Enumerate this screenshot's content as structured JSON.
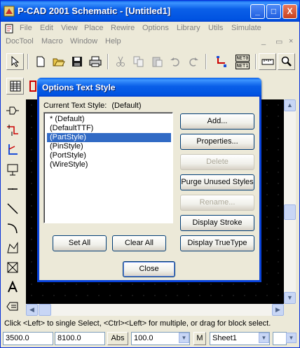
{
  "window": {
    "title": "P-CAD 2001 Schematic - [Untitled1]"
  },
  "title_buttons": {
    "minimize": "_",
    "maximize": "□",
    "close": "X"
  },
  "menu1": [
    "File",
    "Edit",
    "View",
    "Place",
    "Rewire",
    "Options",
    "Library",
    "Utils",
    "Simulate"
  ],
  "menu2": [
    "DocTool",
    "Macro",
    "Window",
    "Help"
  ],
  "toolbar_text": {
    "netlist_top": "NET0",
    "netlist_bottom": "NET1"
  },
  "dialog": {
    "title": "Options Text Style",
    "current_label": "Current Text Style:",
    "current_value": "(Default)",
    "styles": [
      "* (Default)",
      "(DefaultTTF)",
      "(PartStyle)",
      "(PinStyle)",
      "(PortStyle)",
      "(WireStyle)"
    ],
    "selected_index": 2,
    "buttons": {
      "add": "Add...",
      "properties": "Properties...",
      "delete": "Delete",
      "purge": "Purge Unused Styles",
      "rename": "Rename...",
      "display_stroke": "Display Stroke",
      "set_all": "Set All",
      "clear_all": "Clear All",
      "display_truetype": "Display TrueType",
      "close": "Close"
    }
  },
  "status": {
    "message": "Click <Left> to single Select, <Ctrl><Left> for multiple, or drag for block select.",
    "x": "3500.0",
    "y": "8100.0",
    "abs": "Abs",
    "zoom": "100.0",
    "m": "M",
    "sheet": "Sheet1"
  },
  "colors": {
    "title_blue": "#0a5fe8",
    "selection": "#316ac5",
    "canvas": "#000000"
  }
}
